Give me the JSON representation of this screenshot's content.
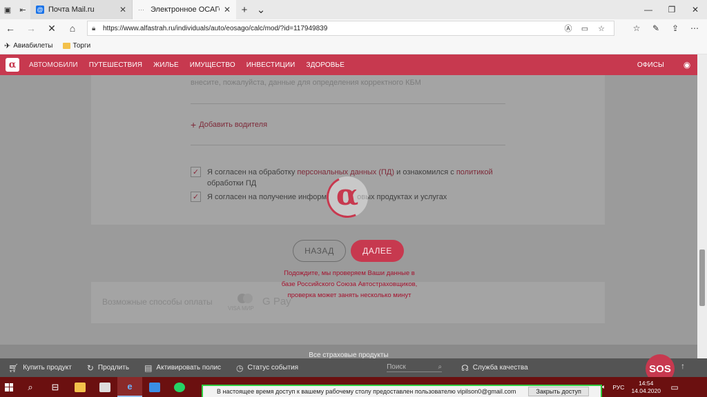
{
  "browser": {
    "tabs": [
      {
        "title": "Почта Mail.ru",
        "icon": "mail-icon"
      },
      {
        "title": "Электронное ОСАГО",
        "icon": "loading-icon"
      }
    ],
    "address": "https://www.alfastrah.ru/individuals/auto/eosago/calc/mod/?id=117949839",
    "bookmarks": [
      {
        "label": "Авиабилеты",
        "icon": "plane-icon"
      },
      {
        "label": "Торги",
        "icon": "folder-icon"
      }
    ]
  },
  "site": {
    "logo": "α",
    "nav": [
      "АВТОМОБИЛИ",
      "ПУТЕШЕСТВИЯ",
      "ЖИЛЬЕ",
      "ИМУЩЕСТВО",
      "ИНВЕСТИЦИИ",
      "ЗДОРОВЬЕ"
    ],
    "offices": "ОФИСЫ"
  },
  "form": {
    "hint": "внесите, пожалуйста, данные для определения корректного КБМ",
    "add_driver": "Добавить водителя",
    "consent1": {
      "prefix": "Я согласен на обработку ",
      "link1": "персональных данных (ПД)",
      "mid": " и ознакомился с ",
      "link2": "политикой",
      "suffix": "обработки ПД",
      "checked": true
    },
    "consent2": {
      "prefix": "Я согласен на получение информ",
      "suffix": "овых продуктах и услугах",
      "checked": true
    },
    "back_label": "НАЗАД",
    "next_label": "ДАЛЕЕ",
    "wait_message": {
      "line1": "Подождите, мы проверяем Ваши данные в",
      "line2": "базе Российского Союза Автостраховщиков,",
      "line3": "проверка может занять несколько минут"
    }
  },
  "payment": {
    "title": "Возможные способы оплаты",
    "mir": "VISA МИР",
    "gpay": "G Pay"
  },
  "footer": {
    "all_products": "Все страховые продукты"
  },
  "bottom_bar": {
    "buy": "Купить продукт",
    "renew": "Продлить",
    "activate": "Активировать полис",
    "status": "Статус события",
    "search_placeholder": "Поиск",
    "quality": "Служба качества",
    "sos": "SOS"
  },
  "taskbar": {
    "lang": "РУС",
    "time": "14:54",
    "date": "14.04.2020",
    "notice": "В настоящее время доступ к вашему рабочему столу предоставлен пользователю vipilson0@gmail.com",
    "close_access": "Закрыть доступ"
  },
  "colors": {
    "brand": "#c7394f",
    "taskbar": "#6b1010"
  }
}
